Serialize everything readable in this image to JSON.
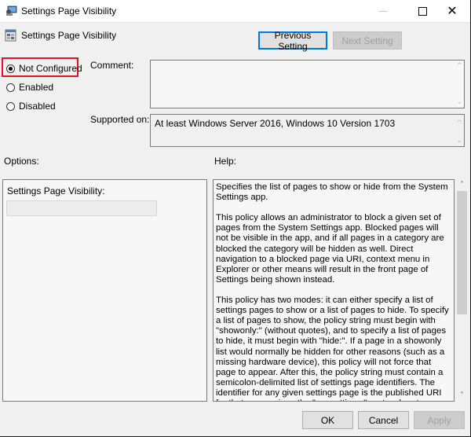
{
  "window": {
    "title": "Settings Page Visibility",
    "controls": {
      "minimize": "minimize",
      "maximize": "maximize",
      "close": "close"
    }
  },
  "header": {
    "title": "Settings Page Visibility",
    "previous_label": "Previous Setting",
    "next_label": "Next Setting"
  },
  "state": {
    "options": [
      {
        "label": "Not Configured",
        "selected": true
      },
      {
        "label": "Enabled",
        "selected": false
      },
      {
        "label": "Disabled",
        "selected": false
      }
    ],
    "highlight_color": "#e81123"
  },
  "comment": {
    "label": "Comment:",
    "value": ""
  },
  "supported": {
    "label": "Supported on:",
    "value": "At least Windows Server 2016, Windows 10 Version 1703"
  },
  "options_section": {
    "label": "Options:",
    "field_label": "Settings Page Visibility:",
    "field_value": ""
  },
  "help_section": {
    "label": "Help:",
    "paragraphs": [
      "Specifies the list of pages to show or hide from the System Settings app.",
      "This policy allows an administrator to block a given set of pages from the System Settings app. Blocked pages will not be visible in the app, and if all pages in a category are blocked the category will be hidden as well. Direct navigation to a blocked page via URI, context menu in Explorer or other means will result in the front page of Settings being shown instead.",
      "This policy has two modes: it can either specify a list of settings pages to show or a list of pages to hide. To specify a list of pages to show, the policy string must begin with \"showonly:\" (without quotes), and to specify a list of pages to hide, it must begin with \"hide:\". If a page in a showonly list would normally be hidden for other reasons (such as a missing hardware device), this policy will not force that page to appear. After this, the policy string must contain a semicolon-delimited list of settings page identifiers. The identifier for any given settings page is the published URI for that page, minus the \"ms-settings:\" protocol part."
    ],
    "scroll_position": 0.0,
    "visible_fraction": 0.62
  },
  "footer": {
    "ok_label": "OK",
    "cancel_label": "Cancel",
    "apply_label": "Apply"
  },
  "colors": {
    "accent": "#0078d7",
    "dialog_bg": "#f0f0f0"
  }
}
